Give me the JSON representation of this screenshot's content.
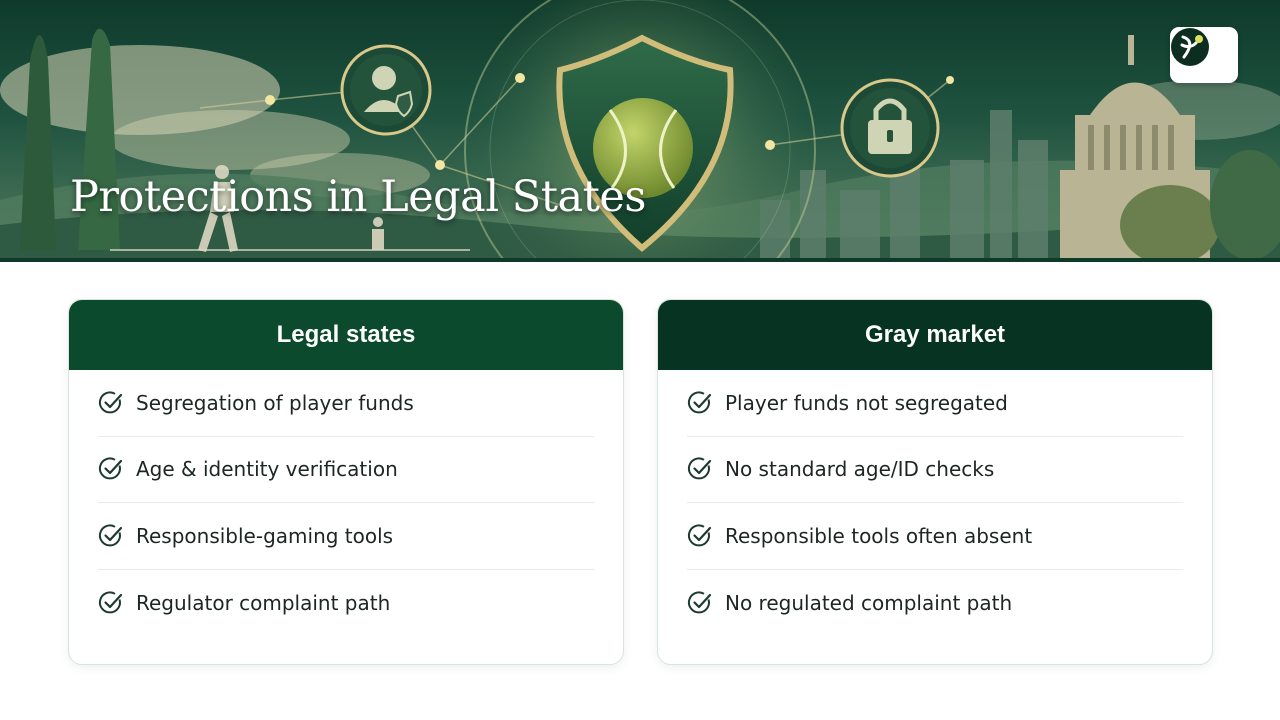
{
  "banner": {
    "title": "Protections in Legal States",
    "logo_icon": "tennis-ball-logo-icon",
    "illustration_icons": [
      "user-verified-icon",
      "shield-tennis-ball-icon",
      "lock-icon"
    ]
  },
  "colors": {
    "banner_dark": "#0f3a2b",
    "legal_header": "#0b4a2c",
    "gray_header": "#073322",
    "check_icon": "#1d3a30"
  },
  "cards": {
    "legal": {
      "title": "Legal states",
      "items": [
        {
          "label": "Segregation of player funds",
          "icon": "check-circle-icon"
        },
        {
          "label": "Age & identity verification",
          "icon": "check-circle-icon"
        },
        {
          "label": "Responsible-gaming tools",
          "icon": "check-circle-icon"
        },
        {
          "label": "Regulator complaint path",
          "icon": "check-circle-icon"
        }
      ]
    },
    "gray": {
      "title": "Gray market",
      "items": [
        {
          "label": "Player funds not segregated",
          "icon": "check-circle-icon"
        },
        {
          "label": "No standard age/ID checks",
          "icon": "check-circle-icon"
        },
        {
          "label": "Responsible tools often absent",
          "icon": "check-circle-icon"
        },
        {
          "label": "No regulated complaint path",
          "icon": "check-circle-icon"
        }
      ]
    }
  }
}
